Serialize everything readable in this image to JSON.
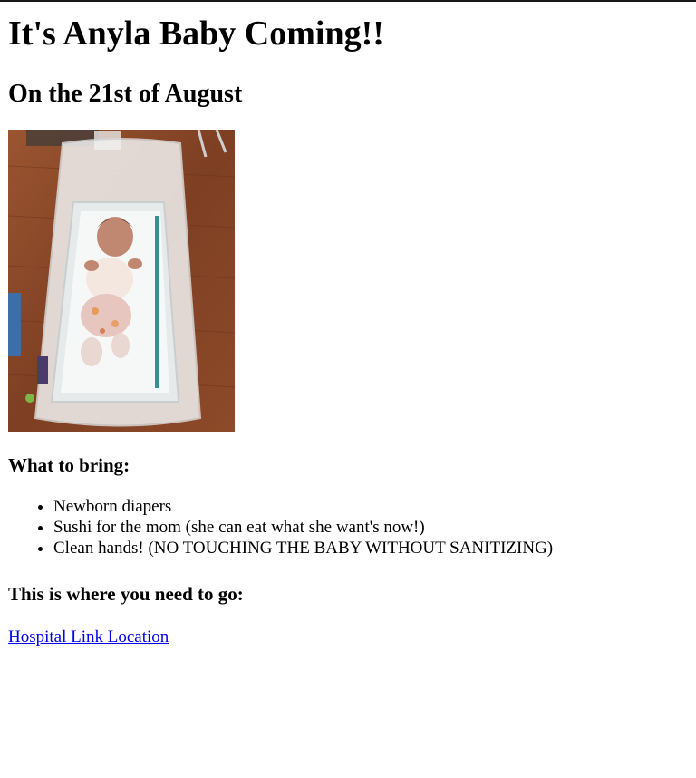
{
  "header": {
    "title": "It's Anyla Baby Coming!!",
    "date": "On the 21st of August"
  },
  "photo": {
    "subject": "newborn baby in hospital bassinet",
    "colors": {
      "floor": "#8b4a2b",
      "blanket": "#eef0f0",
      "bassinet": "#f4f4f4"
    }
  },
  "bring": {
    "heading": "What to bring:",
    "items": [
      "Newborn diapers",
      "Sushi for the mom (she can eat what she want's now!)",
      "Clean hands! (NO TOUCHING THE BABY WITHOUT SANITIZING)"
    ]
  },
  "location": {
    "heading": "This is where you need to go:",
    "link_text": "Hospital Link Location"
  },
  "colors": {
    "link": "#0000ee",
    "text": "#000000"
  }
}
